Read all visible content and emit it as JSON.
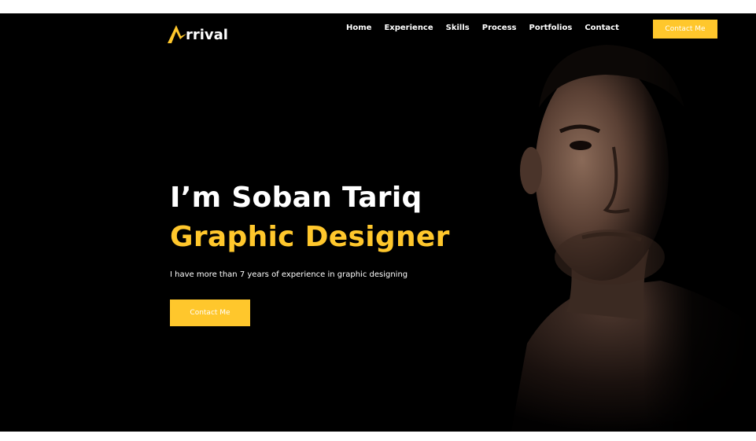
{
  "brand": {
    "logo_letter": "A",
    "logo_rest": "rrival",
    "accent_color": "#ffc72c"
  },
  "nav": {
    "items": [
      "Home",
      "Experience",
      "Skills",
      "Process",
      "Portfolios",
      "Contact"
    ],
    "cta_label": "Contact Me"
  },
  "hero": {
    "name_line": "I’m Soban Tariq",
    "role_line": "Graphic Designer",
    "description": "I have more than 7 years of experience in graphic designing",
    "cta_label": "Contact Me"
  }
}
